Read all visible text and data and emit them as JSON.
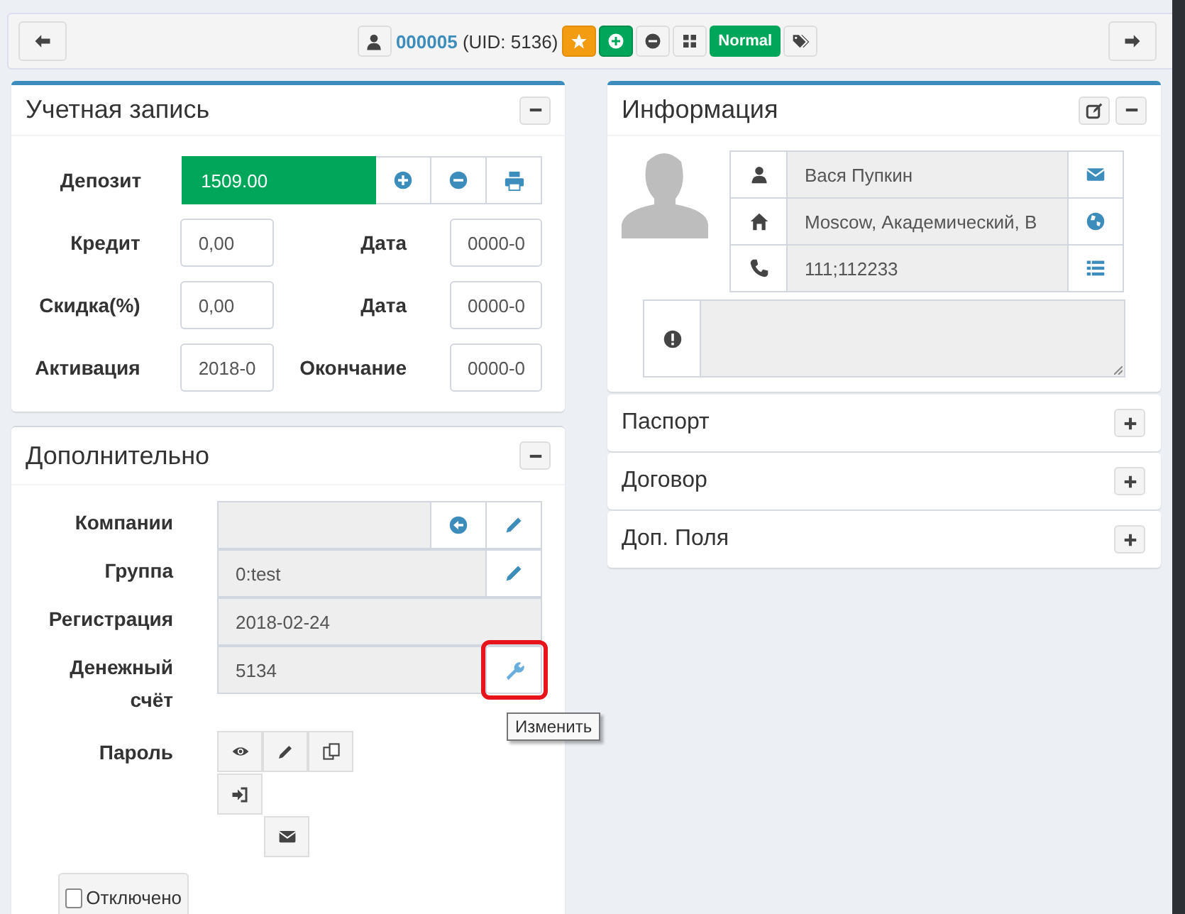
{
  "toolbar": {
    "user_id": "000005",
    "uid": "(UID: 5136)",
    "status": "Normal",
    "favorite": true
  },
  "account": {
    "title": "Учетная запись",
    "deposit_label": "Депозит",
    "deposit": "1509.00",
    "rows": [
      {
        "label": "Кредит",
        "value": "0,00",
        "date_label": "Дата",
        "date_value": "0000-0"
      },
      {
        "label": "Скидка(%)",
        "value": "0,00",
        "date_label": "Дата",
        "date_value": "0000-0"
      },
      {
        "label": "Активация",
        "value": "2018-0",
        "date_label": "Окончание",
        "date_value": "0000-0"
      }
    ]
  },
  "extra": {
    "title": "Дополнительно",
    "rows": [
      {
        "kind": "company",
        "label": "Компании",
        "highlighted": false
      },
      {
        "kind": "group",
        "label": "Группа",
        "value": "0:test",
        "highlighted": false
      },
      {
        "kind": "date",
        "label": "Регистрация",
        "value": "2018-02-24",
        "highlighted": false
      },
      {
        "kind": "wallet",
        "label": "Денежный счёт",
        "value": "5134",
        "highlighted": true
      }
    ],
    "tooltip": "Изменить",
    "password_label": "Пароль",
    "disabled": {
      "label": "Отключено",
      "checked": false
    }
  },
  "info": {
    "title": "Информация",
    "name": "Вася Пупкин",
    "address": "Moscow, Академический, В",
    "phone": "111;112233"
  },
  "sections": [
    {
      "title": "Паспорт",
      "expanded": false
    },
    {
      "title": "Договор",
      "expanded": false
    },
    {
      "title": "Доп. Поля",
      "expanded": false
    }
  ]
}
